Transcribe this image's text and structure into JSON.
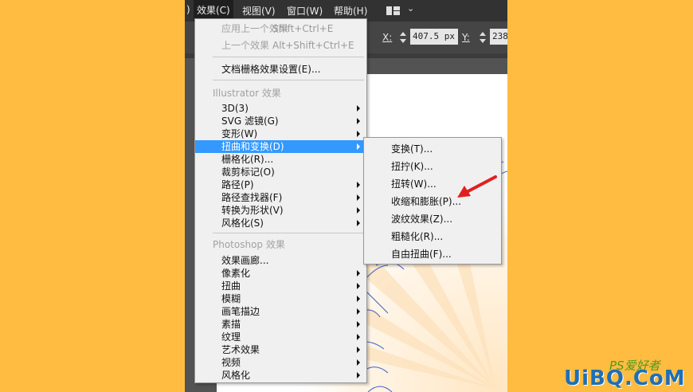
{
  "menubar": {
    "items": [
      {
        "label": ")"
      },
      {
        "label": "效果(C)"
      },
      {
        "label": "视图(V)"
      },
      {
        "label": "窗口(W)"
      },
      {
        "label": "帮助(H)"
      }
    ],
    "workspace_icon": "layout-grid-icon",
    "workspace_caret": "chevron-down-icon"
  },
  "controlbar": {
    "x_label": "X:",
    "x_value": "407.5 px",
    "y_label": "Y:",
    "y_value": "238"
  },
  "effect_menu": {
    "items": [
      {
        "label": "应用上一个效果",
        "shortcut": "Shift+Ctrl+E",
        "disabled": true
      },
      {
        "label": "上一个效果",
        "shortcut": "Alt+Shift+Ctrl+E",
        "disabled": true
      },
      {
        "label": "文档栅格效果设置(E)..."
      },
      {
        "label": "Illustrator 效果",
        "header": true
      },
      {
        "label": "3D(3)",
        "submenu": true
      },
      {
        "label": "SVG 滤镜(G)",
        "submenu": true
      },
      {
        "label": "变形(W)",
        "submenu": true
      },
      {
        "label": "扭曲和变换(D)",
        "submenu": true,
        "highlighted": true
      },
      {
        "label": "栅格化(R)..."
      },
      {
        "label": "裁剪标记(O)"
      },
      {
        "label": "路径(P)",
        "submenu": true
      },
      {
        "label": "路径查找器(F)",
        "submenu": true
      },
      {
        "label": "转换为形状(V)",
        "submenu": true
      },
      {
        "label": "风格化(S)",
        "submenu": true
      },
      {
        "label": "Photoshop 效果",
        "header": true
      },
      {
        "label": "效果画廊..."
      },
      {
        "label": "像素化",
        "submenu": true
      },
      {
        "label": "扭曲",
        "submenu": true
      },
      {
        "label": "模糊",
        "submenu": true
      },
      {
        "label": "画笔描边",
        "submenu": true
      },
      {
        "label": "素描",
        "submenu": true
      },
      {
        "label": "纹理",
        "submenu": true
      },
      {
        "label": "艺术效果",
        "submenu": true
      },
      {
        "label": "视频",
        "submenu": true
      },
      {
        "label": "风格化",
        "submenu": true
      }
    ]
  },
  "distort_submenu": {
    "items": [
      {
        "label": "变换(T)..."
      },
      {
        "label": "扭拧(K)..."
      },
      {
        "label": "扭转(W)..."
      },
      {
        "label": "收缩和膨胀(P)..."
      },
      {
        "label": "波纹效果(Z)..."
      },
      {
        "label": "粗糙化(R)..."
      },
      {
        "label": "自由扭曲(F)..."
      }
    ]
  },
  "annotation": {
    "icon": "red-arrow-icon",
    "color": "#e02020"
  },
  "watermark": {
    "cn": "PS爱好者",
    "en": "UiBQ.CoM"
  },
  "colors": {
    "background": "#ffbc40",
    "highlight": "#3399ff",
    "menubar": "#323232",
    "menu_bg": "#f0f0f0"
  }
}
